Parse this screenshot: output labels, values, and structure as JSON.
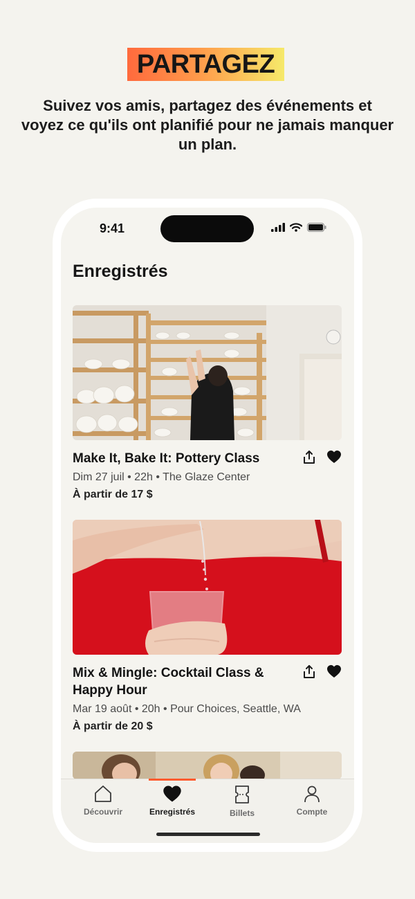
{
  "hero": {
    "badge": "PARTAGEZ",
    "subtitle": "Suivez vos amis, partagez des événements et voyez ce qu'ils ont planifié pour ne jamais manquer un plan."
  },
  "status_bar": {
    "time": "9:41"
  },
  "page": {
    "title": "Enregistrés"
  },
  "events": [
    {
      "title": "Make It, Bake It: Pottery Class",
      "meta": "Dim 27 juil • 22h • The Glaze Center",
      "price": "À partir de 17 $"
    },
    {
      "title": "Mix & Mingle: Cocktail Class & Happy Hour",
      "meta": "Mar 19 août • 20h • Pour Choices, Seattle, WA",
      "price": "À partir de 20 $"
    }
  ],
  "tabbar": {
    "items": [
      {
        "label": "Découvrir",
        "icon": "home-icon"
      },
      {
        "label": "Enregistrés",
        "icon": "heart-icon"
      },
      {
        "label": "Billets",
        "icon": "ticket-icon"
      },
      {
        "label": "Compte",
        "icon": "user-icon"
      }
    ],
    "active": "Enregistrés"
  },
  "colors": {
    "accent": "#ff5b2e",
    "background": "#f4f3ee"
  }
}
